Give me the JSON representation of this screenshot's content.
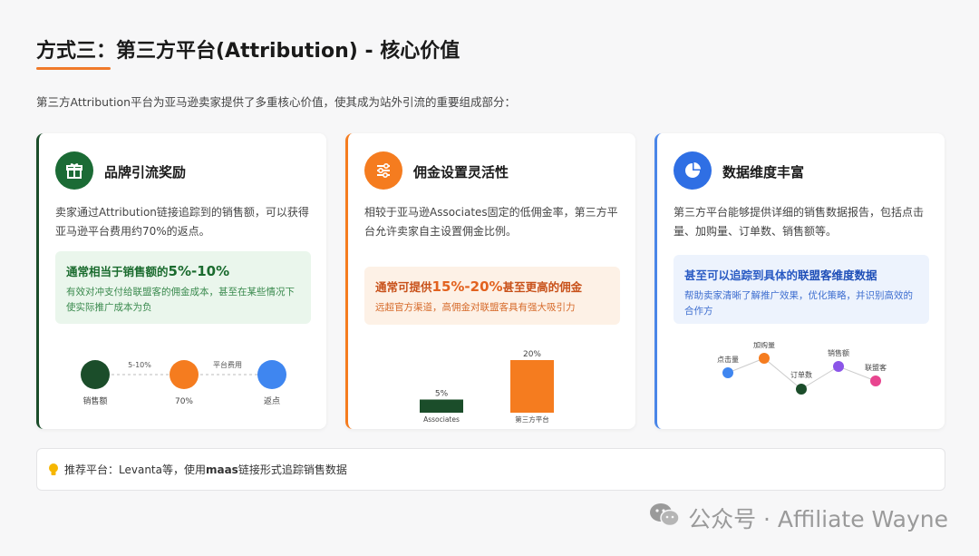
{
  "title": "方式三：第三方平台(Attribution) - 核心价值",
  "intro": "第三方Attribution平台为亚马逊卖家提供了多重核心价值，使其成为站外引流的重要组成部分：",
  "colors": {
    "green": "#1b4d2a",
    "orange": "#f57c1f",
    "blue": "#4a86e8",
    "accent_underline": "#f07a2a"
  },
  "cards": [
    {
      "icon": "gift-icon",
      "title": "品牌引流奖励",
      "desc": "卖家通过Attribution链接追踪到的销售额，可以获得亚马逊平台费用约70%的返点。",
      "highlight_prefix": "通常相当于销售额的",
      "highlight_value": "5%-10%",
      "highlight_suffix": "",
      "highlight_sub": "有效对冲支付给联盟客的佣金成本，甚至在某些情况下使实际推广成本为负",
      "flow": {
        "nodes": [
          "销售额",
          "70%",
          "返点"
        ],
        "edges": [
          "5-10%",
          "平台费用"
        ]
      }
    },
    {
      "icon": "sliders-icon",
      "title": "佣金设置灵活性",
      "desc": "相较于亚马逊Associates固定的低佣金率，第三方平台允许卖家自主设置佣金比例。",
      "highlight_prefix": "通常可提供",
      "highlight_value": "15%-20%",
      "highlight_suffix": "甚至更高的佣金",
      "highlight_sub": "远超官方渠道，高佣金对联盟客具有强大吸引力",
      "chart_data": {
        "type": "bar",
        "categories": [
          "Associates",
          "第三方平台"
        ],
        "values": [
          5,
          20
        ],
        "data_labels": [
          "5%",
          "20%"
        ]
      }
    },
    {
      "icon": "pie-chart-icon",
      "title": "数据维度丰富",
      "desc": "第三方平台能够提供详细的销售数据报告，包括点击量、加购量、订单数、销售额等。",
      "highlight_prefix": "甚至可以追踪到具体的",
      "highlight_value": "联盟客维度数据",
      "highlight_suffix": "",
      "highlight_sub": "帮助卖家清晰了解推广效果，优化策略，并识别高效的合作方",
      "points": [
        "点击量",
        "加购量",
        "订单数",
        "销售额",
        "联盟客"
      ]
    }
  ],
  "tip": {
    "icon": "lightbulb-icon",
    "prefix": "推荐平台：Levanta等，使用",
    "bold": "maas",
    "suffix": "链接形式追踪销售数据"
  },
  "watermark": "公众号 · Affiliate Wayne"
}
